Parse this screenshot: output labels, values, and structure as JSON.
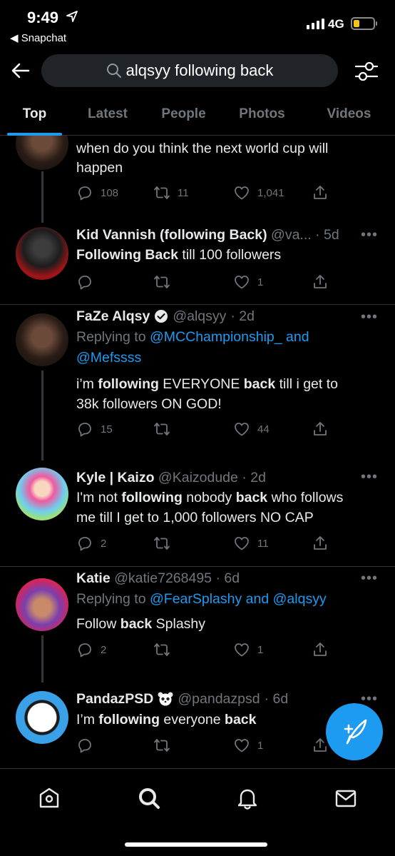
{
  "status": {
    "time": "9:49",
    "back_app": "◀ Snapchat",
    "network": "4G"
  },
  "search": {
    "query": "alqsyy following back"
  },
  "tabs": [
    {
      "label": "Top",
      "active": true
    },
    {
      "label": "Latest"
    },
    {
      "label": "People"
    },
    {
      "label": "Photos"
    },
    {
      "label": "Videos"
    }
  ],
  "tweets": [
    {
      "body_line1": "when do you think the next world cup will",
      "body_line2": "happen",
      "replies": "108",
      "retweets": "11",
      "likes": "1,041"
    },
    {
      "name": "Kid Vannish (following Back)",
      "handle": "@va...",
      "time": "· 5d",
      "body": [
        {
          "t": "Following Back",
          "b": true
        },
        {
          "t": " till 100 followers",
          "b": false
        }
      ],
      "replies": "",
      "retweets": "",
      "likes": "1"
    },
    {
      "name": "FaZe Alqsy",
      "handle": "@alqsyy",
      "time": "· 2d",
      "reply_prefix": "Replying to ",
      "reply_mention1": "@MCChampionship_ and",
      "reply_mention2": "@Mefssss",
      "body_line1": [
        {
          "t": "i’m ",
          "b": false
        },
        {
          "t": "following",
          "b": true
        },
        {
          "t": " EVERYONE ",
          "b": false
        },
        {
          "t": "back",
          "b": true
        },
        {
          "t": " till i get to",
          "b": false
        }
      ],
      "body_line2": "38k followers ON GOD!",
      "replies": "15",
      "retweets": "",
      "likes": "44"
    },
    {
      "name": "Kyle | Kaizo",
      "handle": "@Kaizodude",
      "time": "· 2d",
      "body_line1": [
        {
          "t": "I'm not ",
          "b": false
        },
        {
          "t": "following",
          "b": true
        },
        {
          "t": " nobody ",
          "b": false
        },
        {
          "t": "back",
          "b": true
        },
        {
          "t": " who follows",
          "b": false
        }
      ],
      "body_line2": "me till I get to 1,000 followers NO CAP",
      "replies": "2",
      "retweets": "",
      "likes": "11"
    },
    {
      "name": "Katie",
      "handle": "@katie7268495",
      "time": "· 6d",
      "reply_prefix": "Replying to ",
      "reply_mention1": "@FearSplashy",
      "reply_and": " and ",
      "reply_mention2": "@alqsyy",
      "body": [
        {
          "t": "Follow ",
          "b": false
        },
        {
          "t": "back",
          "b": true
        },
        {
          "t": " Splashy",
          "b": false
        }
      ],
      "replies": "2",
      "retweets": "",
      "likes": "1"
    },
    {
      "name": "PandazPSD",
      "name_emoji": "panda-icon",
      "handle": "@pandazpsd",
      "time": "· 6d",
      "body": [
        {
          "t": "I’m ",
          "b": false
        },
        {
          "t": "following",
          "b": true
        },
        {
          "t": " everyone ",
          "b": false
        },
        {
          "t": "back",
          "b": true
        }
      ],
      "replies": "",
      "retweets": "",
      "likes": "1"
    }
  ],
  "colors": {
    "accent": "#1d9bf0",
    "muted": "#71767b",
    "background": "#000000"
  }
}
